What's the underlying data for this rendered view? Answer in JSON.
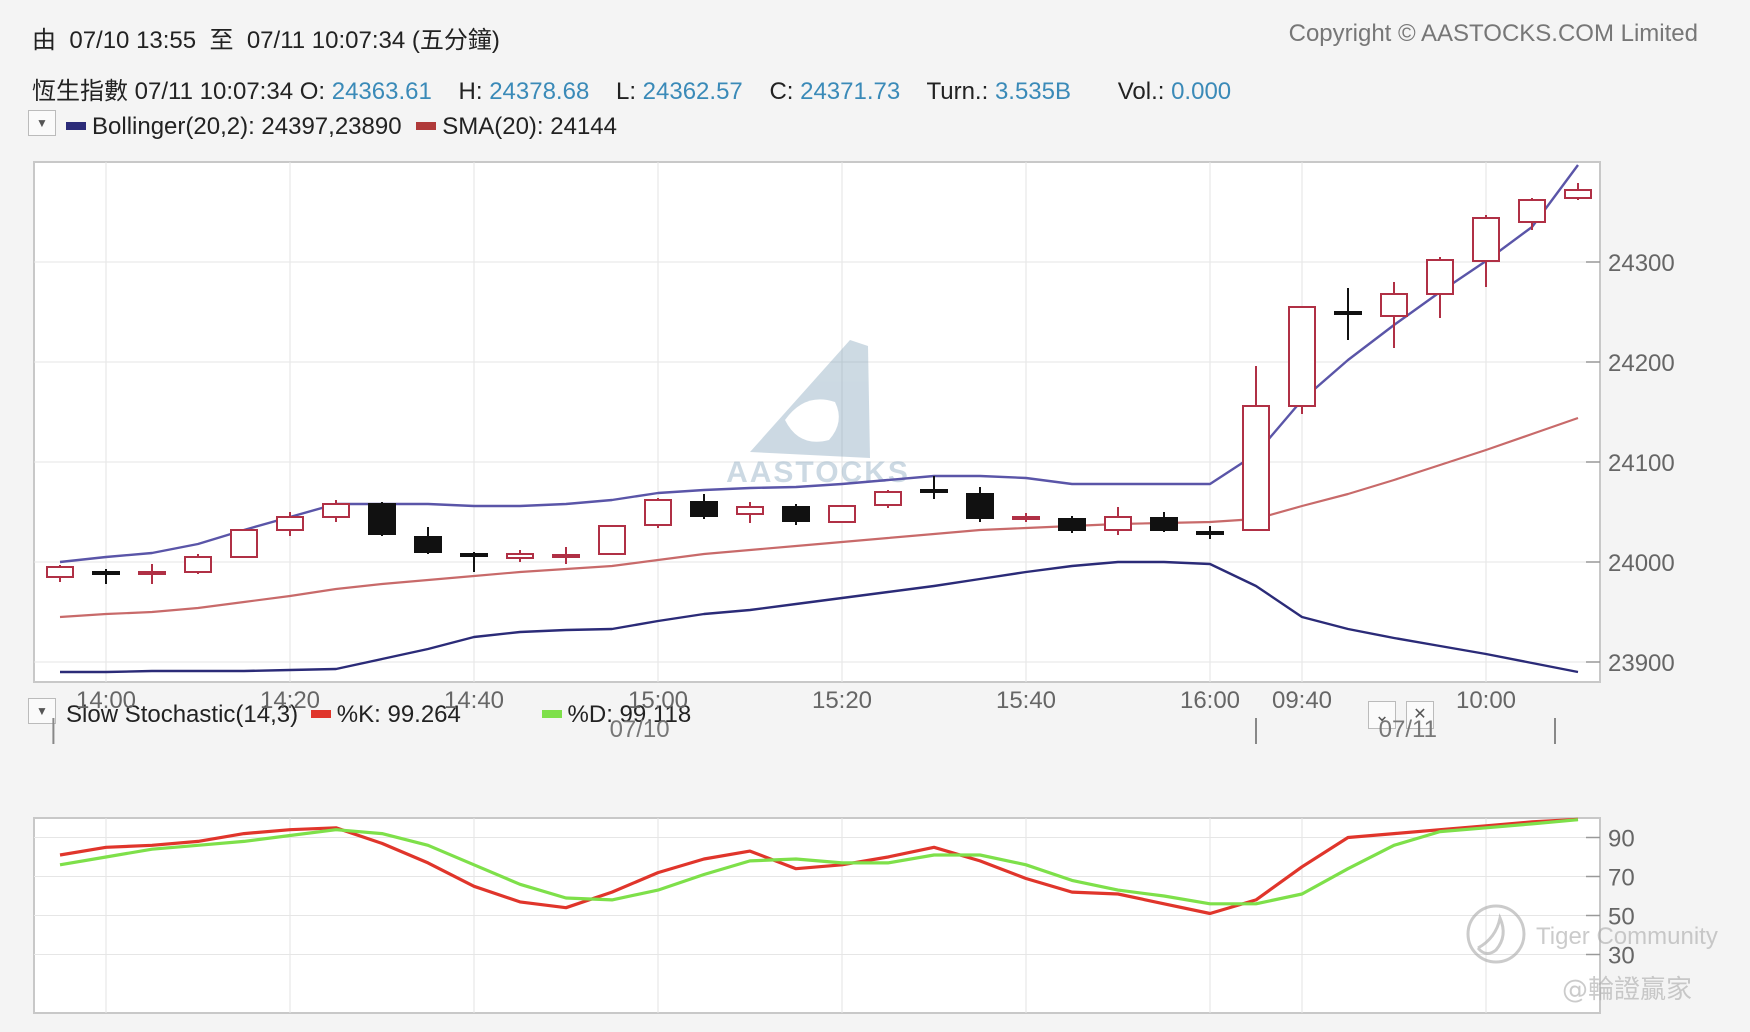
{
  "header": {
    "range_prefix": "由",
    "range_from": "07/10 13:55",
    "range_to_word": "至",
    "range_to": "07/11 10:07:34",
    "range_interval": "(五分鐘)",
    "copyright": "Copyright © AASTOCKS.COM Limited",
    "index_name": "恆生指數",
    "timestamp": "07/11 10:07:34",
    "open_label": "O:",
    "open": "24363.61",
    "high_label": "H:",
    "high": "24378.68",
    "low_label": "L:",
    "low": "24362.57",
    "close_label": "C:",
    "close": "24371.73",
    "turnover_label": "Turn.:",
    "turnover": "3.535B",
    "volume_label": "Vol.:",
    "volume": "0.000"
  },
  "main_legend": {
    "bollinger": "Bollinger(20,2): 24397,23890",
    "bollinger_color": "#2b2b78",
    "sma": "SMA(20): 24144",
    "sma_color": "#b03a3a"
  },
  "stoch_legend": {
    "title": "Slow Stochastic(14,3)",
    "k": "%K: 99.264",
    "k_color": "#e0352b",
    "d": "%D: 99.118",
    "d_color": "#7ee04a"
  },
  "watermark": {
    "logo_text": "AASTOCKS",
    "community": "Tiger Community",
    "handle": "@輪證贏家"
  },
  "chart_data": [
    {
      "type": "candlestick",
      "ylim": [
        23880,
        24400
      ],
      "y_ticks": [
        "24300",
        "24200",
        "24100",
        "24000",
        "23900"
      ],
      "x_tick_labels": [
        "14:00",
        "14:20",
        "14:40",
        "15:00",
        "15:20",
        "15:40",
        "16:00",
        "09:40",
        "10:00"
      ],
      "date_labels": [
        "07/10",
        "07/11"
      ],
      "candles": [
        {
          "o": 23985,
          "h": 23997,
          "l": 23980,
          "c": 23995
        },
        {
          "o": 23990,
          "h": 23993,
          "l": 23978,
          "c": 23988
        },
        {
          "o": 23988,
          "h": 23998,
          "l": 23978,
          "c": 23990
        },
        {
          "o": 23990,
          "h": 24008,
          "l": 23988,
          "c": 24005
        },
        {
          "o": 24005,
          "h": 24033,
          "l": 24004,
          "c": 24032
        },
        {
          "o": 24032,
          "h": 24050,
          "l": 24026,
          "c": 24045
        },
        {
          "o": 24045,
          "h": 24062,
          "l": 24040,
          "c": 24058
        },
        {
          "o": 24058,
          "h": 24060,
          "l": 24026,
          "c": 24028
        },
        {
          "o": 24025,
          "h": 24035,
          "l": 24008,
          "c": 24010
        },
        {
          "o": 24008,
          "h": 24010,
          "l": 23990,
          "c": 24006
        },
        {
          "o": 24004,
          "h": 24012,
          "l": 24000,
          "c": 24008
        },
        {
          "o": 24006,
          "h": 24015,
          "l": 23998,
          "c": 24007
        },
        {
          "o": 24008,
          "h": 24037,
          "l": 24007,
          "c": 24036
        },
        {
          "o": 24037,
          "h": 24064,
          "l": 24034,
          "c": 24062
        },
        {
          "o": 24060,
          "h": 24068,
          "l": 24043,
          "c": 24046
        },
        {
          "o": 24048,
          "h": 24060,
          "l": 24039,
          "c": 24055
        },
        {
          "o": 24055,
          "h": 24058,
          "l": 24037,
          "c": 24041
        },
        {
          "o": 24040,
          "h": 24057,
          "l": 24039,
          "c": 24056
        },
        {
          "o": 24057,
          "h": 24072,
          "l": 24054,
          "c": 24070
        },
        {
          "o": 24072,
          "h": 24086,
          "l": 24063,
          "c": 24070
        },
        {
          "o": 24068,
          "h": 24075,
          "l": 24040,
          "c": 24044
        },
        {
          "o": 24045,
          "h": 24049,
          "l": 24040,
          "c": 24045
        },
        {
          "o": 24043,
          "h": 24046,
          "l": 24029,
          "c": 24032
        },
        {
          "o": 24032,
          "h": 24055,
          "l": 24027,
          "c": 24045
        },
        {
          "o": 24044,
          "h": 24050,
          "l": 24030,
          "c": 24032
        },
        {
          "o": 24030,
          "h": 24036,
          "l": 24023,
          "c": 24029
        },
        {
          "o": 24032,
          "h": 24196,
          "l": 24031,
          "c": 24156
        },
        {
          "o": 24156,
          "h": 24256,
          "l": 24148,
          "c": 24255
        },
        {
          "o": 24250,
          "h": 24274,
          "l": 24222,
          "c": 24248
        },
        {
          "o": 24246,
          "h": 24280,
          "l": 24214,
          "c": 24268
        },
        {
          "o": 24268,
          "h": 24305,
          "l": 24244,
          "c": 24302
        },
        {
          "o": 24301,
          "h": 24347,
          "l": 24275,
          "c": 24344
        },
        {
          "o": 24340,
          "h": 24364,
          "l": 24332,
          "c": 24362
        },
        {
          "o": 24364,
          "h": 24379,
          "l": 24362,
          "c": 24372
        }
      ],
      "bollinger_upper": [
        24000,
        24005,
        24009,
        24018,
        24032,
        24045,
        24058,
        24058,
        24058,
        24056,
        24056,
        24058,
        24062,
        24069,
        24072,
        24074,
        24075,
        24078,
        24082,
        24086,
        24086,
        24084,
        24078,
        24078,
        24078,
        24078,
        24108,
        24162,
        24202,
        24237,
        24270,
        24301,
        24335,
        24397
      ],
      "bollinger_lower": [
        23890,
        23890,
        23891,
        23891,
        23891,
        23892,
        23893,
        23903,
        23913,
        23925,
        23930,
        23932,
        23933,
        23941,
        23948,
        23952,
        23958,
        23964,
        23970,
        23976,
        23983,
        23990,
        23996,
        24000,
        24000,
        23998,
        23976,
        23945,
        23933,
        23924,
        23916,
        23908,
        23899,
        23890
      ],
      "sma": [
        23945,
        23948,
        23950,
        23954,
        23960,
        23966,
        23973,
        23978,
        23982,
        23986,
        23990,
        23993,
        23996,
        24002,
        24008,
        24012,
        24016,
        24020,
        24024,
        24028,
        24032,
        24034,
        24036,
        24038,
        24039,
        24040,
        24043,
        24056,
        24068,
        24082,
        24097,
        24112,
        24128,
        24144
      ]
    },
    {
      "type": "line",
      "title": "Slow Stochastic(14,3)",
      "ylim": [
        0,
        100
      ],
      "y_ticks": [
        "90",
        "70",
        "50",
        "30"
      ],
      "series": [
        {
          "name": "%K",
          "values": [
            81,
            85,
            86,
            88,
            92,
            94,
            95,
            87,
            77,
            65,
            57,
            54,
            62,
            72,
            79,
            83,
            74,
            76,
            80,
            85,
            78,
            69,
            62,
            61,
            56,
            51,
            58,
            75,
            90,
            92,
            94,
            96,
            98,
            99.264
          ]
        },
        {
          "name": "%D",
          "values": [
            76,
            80,
            84,
            86,
            88,
            91,
            94,
            92,
            86,
            76,
            66,
            59,
            58,
            63,
            71,
            78,
            79,
            77,
            77,
            81,
            81,
            76,
            68,
            63,
            60,
            56,
            56,
            61,
            74,
            86,
            93,
            95,
            97,
            99.118
          ]
        }
      ]
    }
  ]
}
